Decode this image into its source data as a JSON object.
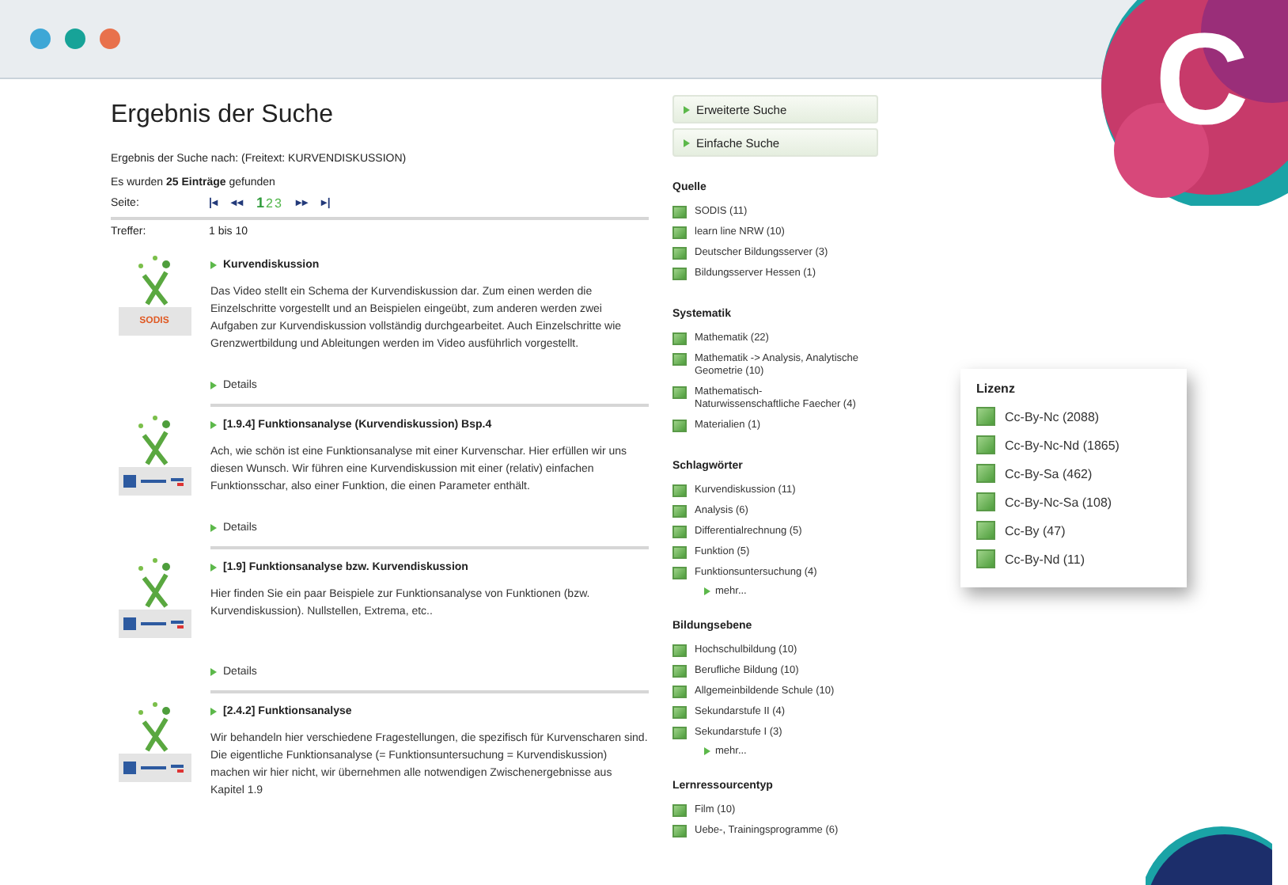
{
  "window": {
    "dots": [
      {
        "color": "#3ea7d6"
      },
      {
        "color": "#17a398"
      },
      {
        "color": "#e8714c"
      }
    ]
  },
  "corner_logo": "C",
  "results_page": {
    "title": "Ergebnis der Suche",
    "query": "Ergebnis der Suche nach: (Freitext: KURVENDISKUSSION)",
    "count": "Es wurden **25 Einträge** gefunden",
    "pager": {
      "label": "Seite:",
      "controls_before": [
        "|◂",
        "◂◂"
      ],
      "pages": [
        {
          "label": "1",
          "selected": true
        },
        {
          "label": "2",
          "selected": false
        },
        {
          "label": "3",
          "selected": false
        }
      ],
      "controls_after": [
        "▸▸",
        "▸|"
      ]
    },
    "hits_label": "Treffer:",
    "hits_value": "1 bis 10"
  },
  "results": [
    {
      "kind": "sodis",
      "logo_text": "SODIS",
      "title": "Kurvendiskussion",
      "description": "Das Video stellt ein Schema der Kurvendiskussion dar. Zum einen werden die Einzelschritte vorgestellt und an Beispielen eingeübt, zum anderen werden zwei Aufgaben zur Kurvendiskussion vollständig durchgearbeitet. Auch Einzelschritte wie Grenzwertbildung und Ableitungen werden im Video ausführlich vorgestellt.",
      "details": "Details"
    },
    {
      "kind": "learnline",
      "title": "[1.9.4] Funktionsanalyse (Kurvendiskussion) Bsp.4",
      "description": "Ach, wie schön ist eine Funktionsanalyse mit einer Kurvenschar. Hier erfüllen wir uns diesen Wunsch. Wir führen eine Kurvendiskussion mit einer (relativ) einfachen Funktionsschar, also einer Funktion, die einen Parameter enthält.",
      "details": "Details"
    },
    {
      "kind": "learnline",
      "title": "[1.9] Funktionsanalyse bzw. Kurvendiskussion",
      "description": "Hier finden Sie ein paar Beispiele zur Funktionsanalyse von Funktionen (bzw. Kurvendiskussion). Nullstellen, Extrema, etc..",
      "details": "Details"
    },
    {
      "kind": "learnline",
      "title": "[2.4.2] Funktionsanalyse",
      "description": "Wir behandeln hier verschiedene Fragestellungen, die spezifisch für Kurvenscharen sind. Die eigentliche Funktionsanalyse (= Funktionsuntersuchung = Kurvendiskussion) machen wir hier nicht, wir übernehmen alle notwendigen Zwischenergebnisse aus Kapitel 1.9"
    }
  ],
  "sidebar": {
    "buttons": [
      "Erweiterte Suche",
      "Einfache Suche"
    ],
    "facets": [
      {
        "title": "Quelle",
        "items": [
          "SODIS (11)",
          "learn line NRW (10)",
          "Deutscher Bildungsserver (3)",
          "Bildungsserver Hessen (1)"
        ]
      },
      {
        "title": "Systematik",
        "items": [
          "Mathematik (22)",
          "Mathematik -> Analysis, Analytische Geometrie (10)",
          "Mathematisch-Naturwissenschaftliche Faecher (4)",
          "Materialien (1)"
        ]
      },
      {
        "title": "Schlagwörter",
        "items": [
          "Kurvendiskussion (11)",
          "Analysis (6)",
          "Differentialrechnung (5)",
          "Funktion (5)",
          "Funktionsuntersuchung (4)"
        ],
        "more": "mehr..."
      },
      {
        "title": "Bildungsebene",
        "items": [
          "Hochschulbildung (10)",
          "Berufliche Bildung (10)",
          "Allgemeinbildende Schule (10)",
          "Sekundarstufe II (4)",
          "Sekundarstufe I (3)"
        ],
        "more": "mehr..."
      },
      {
        "title": "Lernressourcentyp",
        "items": [
          "Film (10)",
          "Uebe-, Trainingsprogramme (6)"
        ]
      }
    ]
  },
  "license_panel": {
    "title": "Lizenz",
    "items": [
      "Cc-By-Nc (2088)",
      "Cc-By-Nc-Nd (1865)",
      "Cc-By-Sa (462)",
      "Cc-By-Nc-Sa (108)",
      "Cc-By (47)",
      "Cc-By-Nd (11)"
    ]
  }
}
